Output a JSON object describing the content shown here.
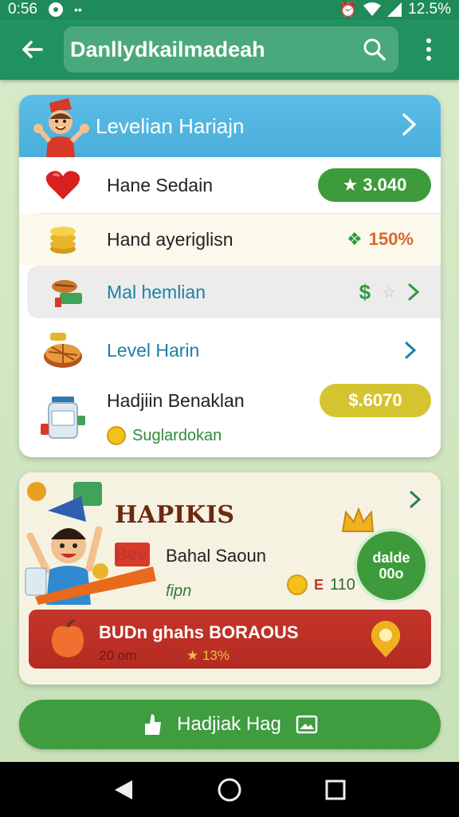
{
  "status": {
    "time": "0:56",
    "battery": "12.5%"
  },
  "appbar": {
    "title": "Danllydkailmadeah"
  },
  "card1": {
    "header": "Levelian Hariajn",
    "rows": [
      {
        "label": "Hane Sedain",
        "value": "3.040"
      },
      {
        "label": "Hand ayeriglisn",
        "value": "150%"
      },
      {
        "label": "Mal hemlian"
      },
      {
        "label": "Level Harin"
      },
      {
        "label": "Hadjiin Benaklan",
        "sublabel": "Suglardokan",
        "value": "$.6070"
      }
    ]
  },
  "card2": {
    "title": "HAPIKIS",
    "ribbon": "Bev",
    "subtitle": "Bahal Saoun",
    "small": "fipn",
    "reward_value": "110",
    "badge_line1": "dalde",
    "badge_line2": "00o",
    "sign": "E",
    "banner_title": "BUDn ghahs BORAOUS",
    "banner_left": "20 om",
    "banner_right": "13%"
  },
  "bottom_button": {
    "label": "Hadjiak Hag"
  },
  "colors": {
    "appbar": "#21915f",
    "green_pill": "#3e9b3c",
    "yellow_pill": "#d4c430",
    "banner": "#c4352a"
  }
}
